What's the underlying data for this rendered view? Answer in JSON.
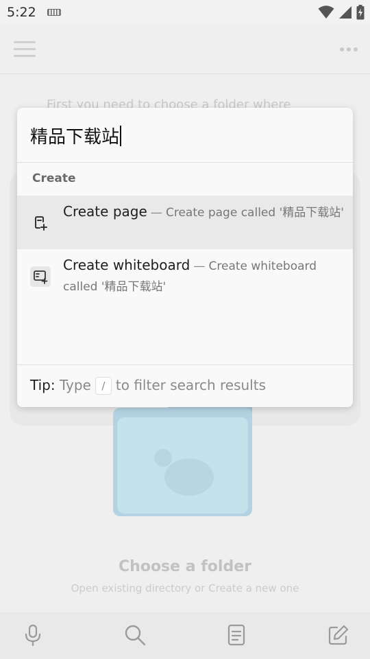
{
  "status_bar": {
    "time": "5:22",
    "icons": [
      "keyboard-icon",
      "wifi-icon",
      "signal-icon",
      "battery-charging-icon"
    ]
  },
  "header": {
    "icons": [
      "menu-icon",
      "more-icon"
    ]
  },
  "background": {
    "hint_text": "First you need to choose a folder where",
    "folder_title": "Choose a folder",
    "folder_subtitle": "Open existing directory or Create a new one"
  },
  "search_popup": {
    "query": "精品下载站",
    "section_label": "Create",
    "items": [
      {
        "title": "Create page",
        "separator": "—",
        "description": "Create page called '精品下载站'",
        "icon": "page-add-icon"
      },
      {
        "title": "Create whiteboard",
        "separator": "—",
        "description": "Create whiteboard called '精品下载站'",
        "icon": "whiteboard-add-icon"
      }
    ],
    "tip": {
      "label": "Tip:",
      "before": "Type",
      "key": "/",
      "after": "to filter search results"
    }
  },
  "bottom_bar": {
    "icons": [
      "microphone-icon",
      "search-icon",
      "document-icon",
      "edit-icon"
    ]
  },
  "colors": {
    "popup_bg": "#f9f9f9",
    "selected_row": "#e9e9e9",
    "folder_blue": "#c3e2ec"
  }
}
